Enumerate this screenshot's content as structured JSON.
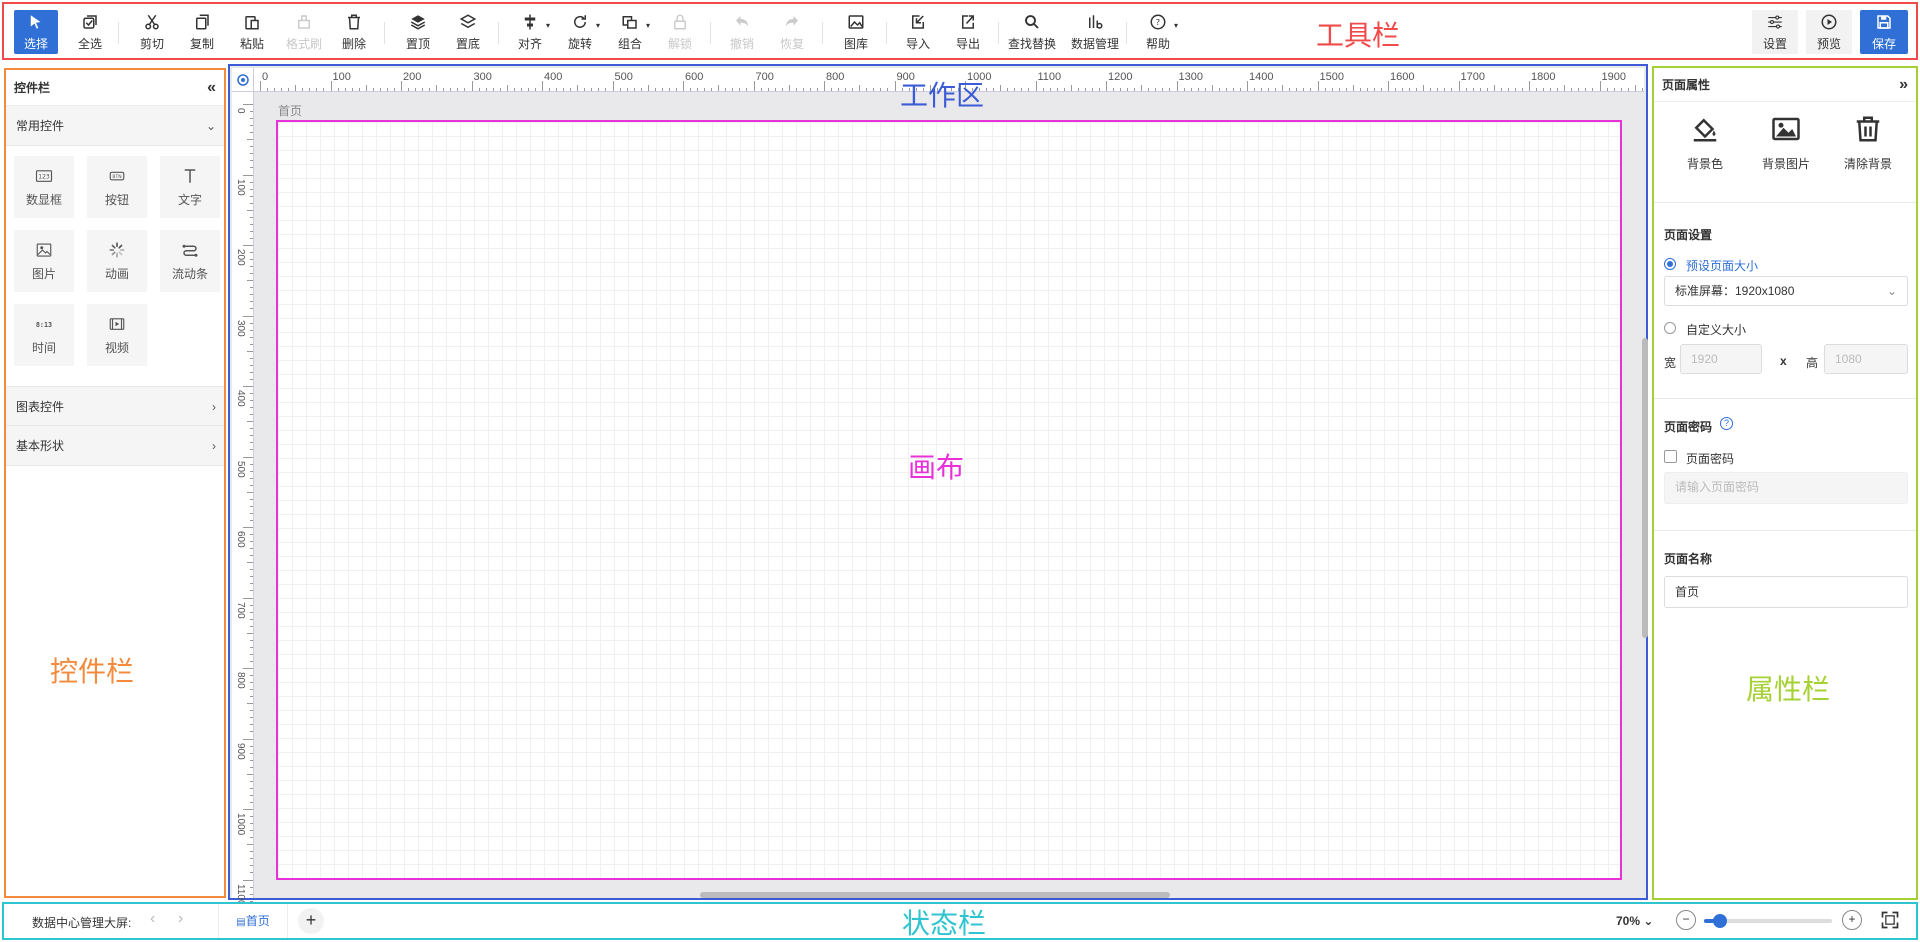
{
  "toolbar": {
    "select": "选择",
    "select_all": "全选",
    "cut": "剪切",
    "copy": "复制",
    "paste": "粘贴",
    "format_brush": "格式刷",
    "delete": "删除",
    "bring_top": "置顶",
    "send_bottom": "置底",
    "align": "对齐",
    "rotate": "旋转",
    "group": "组合",
    "unlock": "解锁",
    "undo": "撤销",
    "redo": "恢复",
    "gallery": "图库",
    "import": "导入",
    "export": "导出",
    "find_replace": "查找替换",
    "data_manage": "数据管理",
    "help": "帮助",
    "settings": "设置",
    "preview": "预览",
    "save": "保存"
  },
  "labels": {
    "toolbar": "工具栏",
    "workspace": "工作区",
    "canvas": "画布",
    "control_bar": "控件栏",
    "property_bar": "属性栏",
    "status_bar": "状态栏"
  },
  "controls": {
    "title": "控件栏",
    "groups": {
      "common": "常用控件",
      "chart": "图表控件",
      "shape": "基本形状"
    },
    "items": [
      {
        "label": "数显框",
        "icon": "numeric-display-icon"
      },
      {
        "label": "按钮",
        "icon": "button-icon"
      },
      {
        "label": "文字",
        "icon": "text-icon"
      },
      {
        "label": "图片",
        "icon": "image-icon"
      },
      {
        "label": "动画",
        "icon": "animation-icon"
      },
      {
        "label": "流动条",
        "icon": "flow-bar-icon"
      },
      {
        "label": "时间",
        "icon": "time-icon"
      },
      {
        "label": "视频",
        "icon": "video-icon"
      }
    ],
    "btn_glyph": "BTN",
    "num_glyph": "123",
    "time_glyph": "8:13"
  },
  "workspace": {
    "page_label": "首页",
    "ruler_x": [
      "0",
      "100",
      "200",
      "300",
      "400",
      "500",
      "600",
      "700",
      "800",
      "900",
      "1000",
      "1100",
      "1200",
      "1300",
      "1400",
      "1500",
      "1600",
      "1700",
      "1800",
      "1900"
    ],
    "ruler_y": [
      "0",
      "100",
      "200",
      "300",
      "400",
      "500",
      "600",
      "700",
      "800",
      "900",
      "1000",
      "1100"
    ]
  },
  "properties": {
    "title": "页面属性",
    "bg_color": "背景色",
    "bg_image": "背景图片",
    "clear_bg": "清除背景",
    "page_settings": "页面设置",
    "preset_size": "预设页面大小",
    "preset_value": "标准屏幕：1920x1080",
    "custom_size": "自定义大小",
    "width_label": "宽",
    "width_value": "1920",
    "x_label": "x",
    "height_label": "高",
    "height_value": "1080",
    "page_password": "页面密码",
    "password_checkbox": "页面密码",
    "password_placeholder": "请输入页面密码",
    "page_name": "页面名称",
    "page_name_value": "首页"
  },
  "status": {
    "project": "数据中心管理大屏:",
    "page_tab": "首页",
    "zoom": "70%",
    "zoom_fraction": 0.07
  }
}
